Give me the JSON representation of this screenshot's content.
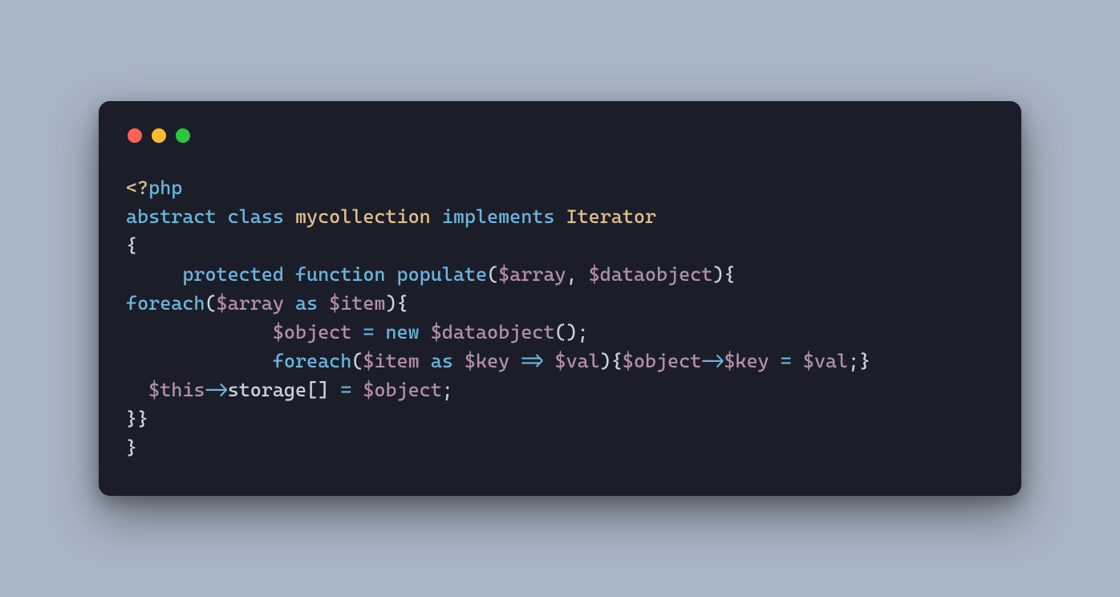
{
  "window": {
    "controls": [
      "close",
      "minimize",
      "zoom"
    ]
  },
  "code": {
    "tokens": [
      [
        {
          "t": "<?",
          "c": "c-tag"
        },
        {
          "t": "php",
          "c": "c-php"
        }
      ],
      [
        {
          "t": "abstract",
          "c": "c-keyword"
        },
        {
          "t": " ",
          "c": "c-default"
        },
        {
          "t": "class",
          "c": "c-keyword"
        },
        {
          "t": " ",
          "c": "c-default"
        },
        {
          "t": "mycollection",
          "c": "c-classname"
        },
        {
          "t": " ",
          "c": "c-default"
        },
        {
          "t": "implements",
          "c": "c-keyword"
        },
        {
          "t": " ",
          "c": "c-default"
        },
        {
          "t": "Iterator",
          "c": "c-classname"
        }
      ],
      [
        {
          "t": "{",
          "c": "c-punct"
        }
      ],
      [
        {
          "t": "     ",
          "c": "c-default"
        },
        {
          "t": "protected",
          "c": "c-keyword"
        },
        {
          "t": " ",
          "c": "c-default"
        },
        {
          "t": "function",
          "c": "c-keyword"
        },
        {
          "t": " ",
          "c": "c-default"
        },
        {
          "t": "populate",
          "c": "c-funcname"
        },
        {
          "t": "(",
          "c": "c-punct"
        },
        {
          "t": "$array",
          "c": "c-var"
        },
        {
          "t": ", ",
          "c": "c-punct"
        },
        {
          "t": "$dataobject",
          "c": "c-var"
        },
        {
          "t": "){",
          "c": "c-punct"
        }
      ],
      [
        {
          "t": "foreach",
          "c": "c-keyword"
        },
        {
          "t": "(",
          "c": "c-punct"
        },
        {
          "t": "$array",
          "c": "c-var"
        },
        {
          "t": " ",
          "c": "c-default"
        },
        {
          "t": "as",
          "c": "c-keyword"
        },
        {
          "t": " ",
          "c": "c-default"
        },
        {
          "t": "$item",
          "c": "c-var"
        },
        {
          "t": "){",
          "c": "c-punct"
        }
      ],
      [
        {
          "t": "             ",
          "c": "c-default"
        },
        {
          "t": "$object",
          "c": "c-var"
        },
        {
          "t": " ",
          "c": "c-default"
        },
        {
          "t": "=",
          "c": "c-op"
        },
        {
          "t": " ",
          "c": "c-default"
        },
        {
          "t": "new",
          "c": "c-keyword"
        },
        {
          "t": " ",
          "c": "c-default"
        },
        {
          "t": "$dataobject",
          "c": "c-var"
        },
        {
          "t": "();",
          "c": "c-punct"
        }
      ],
      [
        {
          "t": "             ",
          "c": "c-default"
        },
        {
          "t": "foreach",
          "c": "c-keyword"
        },
        {
          "t": "(",
          "c": "c-punct"
        },
        {
          "t": "$item",
          "c": "c-var"
        },
        {
          "t": " ",
          "c": "c-default"
        },
        {
          "t": "as",
          "c": "c-keyword"
        },
        {
          "t": " ",
          "c": "c-default"
        },
        {
          "t": "$key",
          "c": "c-var"
        },
        {
          "t": " ",
          "c": "c-default"
        },
        {
          "t": "=>",
          "c": "c-op"
        },
        {
          "t": " ",
          "c": "c-default"
        },
        {
          "t": "$val",
          "c": "c-var"
        },
        {
          "t": "){",
          "c": "c-punct"
        },
        {
          "t": "$object",
          "c": "c-var"
        },
        {
          "t": "->",
          "c": "c-op"
        },
        {
          "t": "$key",
          "c": "c-var"
        },
        {
          "t": " ",
          "c": "c-default"
        },
        {
          "t": "=",
          "c": "c-op"
        },
        {
          "t": " ",
          "c": "c-default"
        },
        {
          "t": "$val",
          "c": "c-var"
        },
        {
          "t": ";}",
          "c": "c-punct"
        }
      ],
      [
        {
          "t": "  ",
          "c": "c-default"
        },
        {
          "t": "$this",
          "c": "c-var"
        },
        {
          "t": "->",
          "c": "c-op"
        },
        {
          "t": "storage",
          "c": "c-prop"
        },
        {
          "t": "[] ",
          "c": "c-punct"
        },
        {
          "t": "=",
          "c": "c-op"
        },
        {
          "t": " ",
          "c": "c-default"
        },
        {
          "t": "$object",
          "c": "c-var"
        },
        {
          "t": ";",
          "c": "c-punct"
        }
      ],
      [
        {
          "t": "}}",
          "c": "c-punct"
        }
      ],
      [
        {
          "t": "}",
          "c": "c-punct"
        }
      ]
    ]
  },
  "colors": {
    "background_page": "#a8b5c4",
    "background_window": "#1b1e28",
    "red": "#ff5f57",
    "yellow": "#febc2e",
    "green": "#28c840"
  }
}
